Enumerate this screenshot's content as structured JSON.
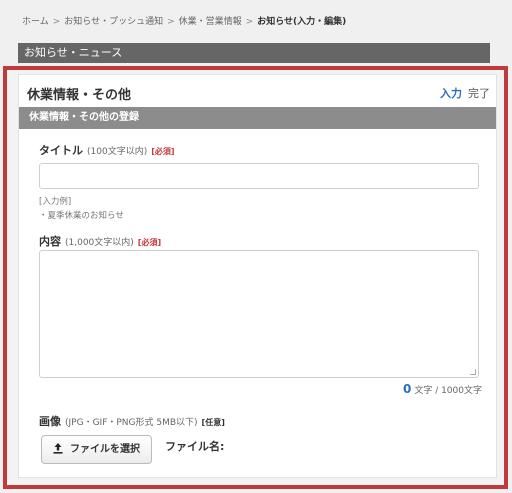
{
  "breadcrumb": [
    "ホーム",
    "お知らせ・プッシュ通知",
    "休業・営業情報",
    "お知らせ(入力・編集)"
  ],
  "news_bar": "お知らせ・ニュース",
  "panel": {
    "title": "休業情報・その他",
    "step_input": "入力",
    "step_done": "完了",
    "section": "休業情報・その他の登録"
  },
  "title_field": {
    "label": "タイトル",
    "hint": "(100文字以内)",
    "required": "[必須]",
    "value": "",
    "example_heading": "[入力例]",
    "example_text": "・夏季休業のお知らせ"
  },
  "content_field": {
    "label": "内容",
    "hint": "(1,000文字以内)",
    "required": "[必須]",
    "value": "",
    "count": "0",
    "count_suffix": "文字 / 1000文字"
  },
  "image_field": {
    "label": "画像",
    "hint": "(JPG・GIF・PNG形式 5MB以下)",
    "optional": "[任意]",
    "button_label": "ファイルを選択",
    "filename_label": "ファイル名:"
  },
  "colors": {
    "frame": "#c0393b",
    "accent": "#2a6ebb",
    "news_bar": "#666666",
    "section_bar": "#8c8c8c"
  },
  "icons": [
    "upload-icon"
  ]
}
